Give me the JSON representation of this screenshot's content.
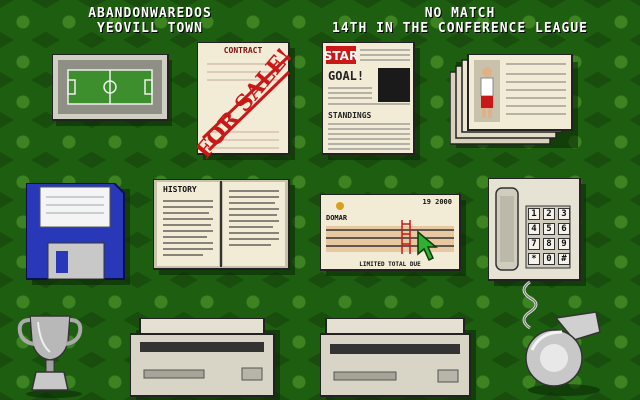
{
  "header": {
    "manager_name": "ABANDONWAREDOS",
    "club_name": "YEOVILL TOWN",
    "match_status": "NO MATCH",
    "league_position": "14TH IN THE CONFERENCE LEAGUE"
  },
  "items": {
    "transfer_sign": {
      "top_text": "CONTRACT",
      "stamp_text": "FOR SALE!"
    },
    "newspaper": {
      "masthead": "STAR",
      "headline": "GOAL!",
      "section": "STANDINGS"
    },
    "history_book": {
      "title": "HISTORY"
    },
    "cheque": {
      "date": "19 2000",
      "payee_label": "DOMAR",
      "footer": "LIMITED TOTAL DUE"
    },
    "telephone": {
      "keys": [
        "1",
        "2",
        "3",
        "4",
        "5",
        "6",
        "7",
        "8",
        "9",
        "*",
        "0",
        "#"
      ]
    }
  },
  "colors": {
    "background": "#1e5e10",
    "accent_red": "#c81818",
    "cream": "#f2ecd6",
    "floppy_blue": "#2838b8"
  }
}
